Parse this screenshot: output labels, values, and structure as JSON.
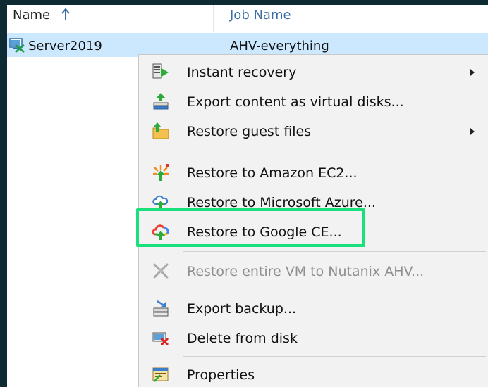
{
  "header": {
    "name_column": "Name",
    "job_column": "Job Name"
  },
  "row": {
    "name": "Server2019",
    "job": "AHV-everything"
  },
  "menu": {
    "items": [
      {
        "label": "Instant recovery",
        "icon": "instant-recovery-icon",
        "submenu": true,
        "enabled": true
      },
      {
        "label": "Export content as virtual disks...",
        "icon": "export-disks-icon",
        "submenu": false,
        "enabled": true
      },
      {
        "label": "Restore guest files",
        "icon": "restore-files-icon",
        "submenu": true,
        "enabled": true
      },
      {
        "label": "Restore to Amazon EC2...",
        "icon": "amazon-ec2-icon",
        "submenu": false,
        "enabled": true
      },
      {
        "label": "Restore to Microsoft Azure...",
        "icon": "azure-cloud-icon",
        "submenu": false,
        "enabled": true
      },
      {
        "label": "Restore to Google CE...",
        "icon": "google-cloud-icon",
        "submenu": false,
        "enabled": true
      },
      {
        "label": "Restore entire VM to Nutanix AHV...",
        "icon": "nutanix-icon",
        "submenu": false,
        "enabled": false
      },
      {
        "label": "Export backup...",
        "icon": "export-backup-icon",
        "submenu": false,
        "enabled": true
      },
      {
        "label": "Delete from disk",
        "icon": "delete-disk-icon",
        "submenu": false,
        "enabled": true
      },
      {
        "label": "Properties",
        "icon": "properties-icon",
        "submenu": false,
        "enabled": true
      }
    ]
  },
  "colors": {
    "highlight": "#19e07a",
    "selection": "#cce8ff",
    "accent_header": "#3a6ea5"
  }
}
